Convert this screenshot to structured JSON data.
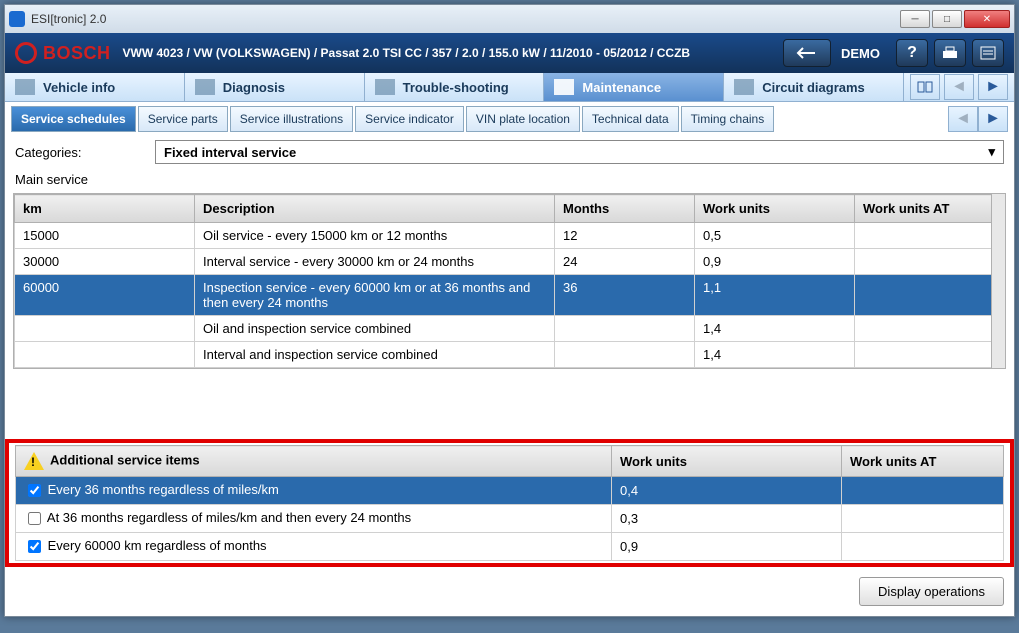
{
  "window_title": "ESI[tronic] 2.0",
  "header": {
    "brand": "BOSCH",
    "vehicle": "VWW 4023 / VW (VOLKSWAGEN) / Passat 2.0 TSI CC / 357 / 2.0 / 155.0 kW / 11/2010 - 05/2012 / CCZB",
    "demo": "DEMO"
  },
  "maintabs": {
    "vehicle_info": "Vehicle info",
    "diagnosis": "Diagnosis",
    "troubleshooting": "Trouble-shooting",
    "maintenance": "Maintenance",
    "circuit": "Circuit diagrams"
  },
  "subtabs": {
    "schedules": "Service schedules",
    "parts": "Service parts",
    "illustrations": "Service illustrations",
    "indicator": "Service indicator",
    "vin": "VIN plate location",
    "technical": "Technical data",
    "timing": "Timing chains"
  },
  "filter": {
    "label": "Categories:",
    "value": "Fixed interval service"
  },
  "section": "Main service",
  "columns": {
    "km": "km",
    "desc": "Description",
    "months": "Months",
    "wu": "Work units",
    "wuat": "Work units AT"
  },
  "rows": [
    {
      "km": "15000",
      "desc": "Oil service - every 15000 km or 12 months",
      "months": "12",
      "wu": "0,5",
      "wuat": ""
    },
    {
      "km": "30000",
      "desc": "Interval service - every 30000 km or 24 months",
      "months": "24",
      "wu": "0,9",
      "wuat": ""
    },
    {
      "km": "60000",
      "desc": "Inspection service - every 60000 km or at 36 months and then every 24 months",
      "months": "36",
      "wu": "1,1",
      "wuat": ""
    },
    {
      "km": "",
      "desc": "Oil and inspection service combined",
      "months": "",
      "wu": "1,4",
      "wuat": ""
    },
    {
      "km": "",
      "desc": "Interval and inspection service combined",
      "months": "",
      "wu": "1,4",
      "wuat": ""
    }
  ],
  "addcols": {
    "title": "Additional service items",
    "wu": "Work units",
    "wuat": "Work units AT"
  },
  "addrows": [
    {
      "checked": true,
      "desc": "Every 36 months regardless of miles/km",
      "wu": "0,4",
      "wuat": ""
    },
    {
      "checked": false,
      "desc": "At 36 months regardless of miles/km and then every 24 months",
      "wu": "0,3",
      "wuat": ""
    },
    {
      "checked": true,
      "desc": "Every 60000 km regardless of months",
      "wu": "0,9",
      "wuat": ""
    }
  ],
  "footer_btn": "Display operations"
}
